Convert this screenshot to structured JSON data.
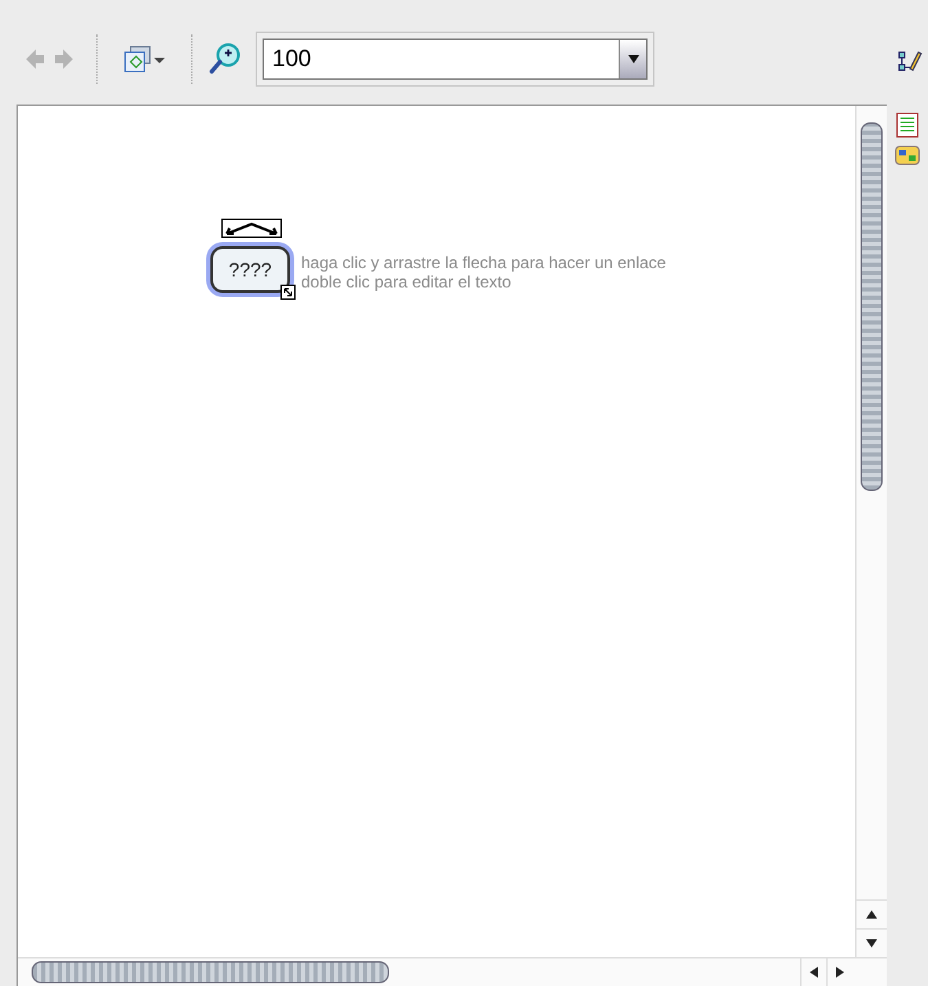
{
  "toolbar": {
    "nav_buttons": [
      {
        "kind": "back",
        "disabled": true
      },
      {
        "kind": "forward",
        "disabled": true
      }
    ],
    "zoom": {
      "value": "100"
    }
  },
  "canvas": {
    "node": {
      "label": "????",
      "selected": true
    },
    "hints": [
      "haga clic y arrastre la flecha para hacer un enlace",
      "doble clic para editar el texto"
    ]
  }
}
